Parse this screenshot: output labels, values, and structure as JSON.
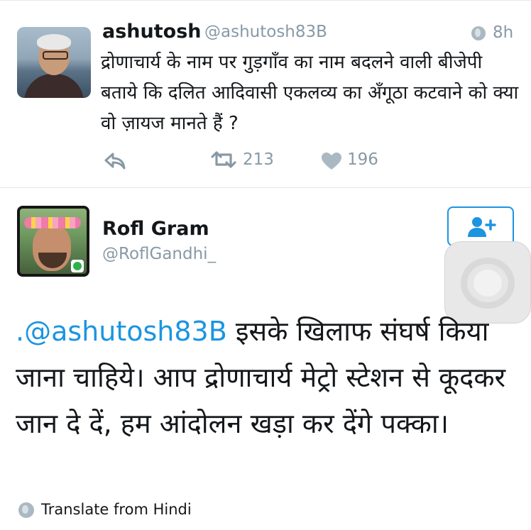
{
  "tweet1": {
    "display_name": "ashutosh",
    "handle": "@ashutosh83B",
    "time": "8h",
    "text": "द्रोणाचार्य के नाम पर गुड़गाँव का नाम बदलने वाली बीजेपी बताये कि दलित आदिवासी एकलव्य का अँगूठा कटवाने को क्या वो ज़ायज मानते हैं ?",
    "retweets": "213",
    "likes": "196",
    "icons": {
      "globe": "globe-icon",
      "reply": "reply-icon",
      "retweet": "retweet-icon",
      "like": "heart-icon"
    }
  },
  "tweet2": {
    "display_name": "Rofl Gram",
    "handle": "@RoflGandhi_",
    "mention": ".@ashutosh83B",
    "text": " इसके खिलाफ संघर्ष किया जाना चाहिये। आप द्रोणाचार्य मेट्रो स्टेशन से कूदकर जान दे दें, हम आंदोलन खड़ा कर देंगे पक्का।",
    "translate_label": "Translate from Hindi",
    "icons": {
      "follow": "add-user-icon",
      "globe": "globe-icon",
      "assistive_touch": "assistive-touch-icon"
    }
  },
  "colors": {
    "accent": "#1b95e0",
    "muted": "#8899a6",
    "text": "#14171a",
    "divider": "#e1e8ed"
  }
}
